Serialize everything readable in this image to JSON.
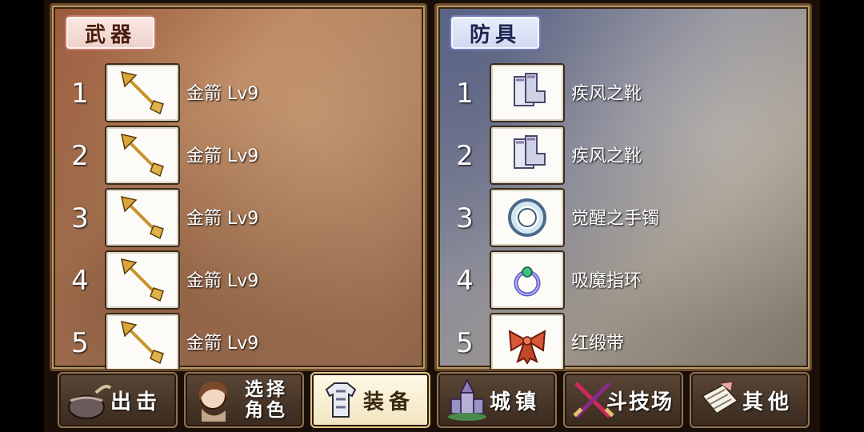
{
  "weapons_panel": {
    "title": "武器",
    "items": [
      {
        "index": "1",
        "name": "金箭 Lv9",
        "icon": "golden-arrow-icon"
      },
      {
        "index": "2",
        "name": "金箭 Lv9",
        "icon": "golden-arrow-icon"
      },
      {
        "index": "3",
        "name": "金箭 Lv9",
        "icon": "golden-arrow-icon"
      },
      {
        "index": "4",
        "name": "金箭 Lv9",
        "icon": "golden-arrow-icon"
      },
      {
        "index": "5",
        "name": "金箭 Lv9",
        "icon": "golden-arrow-icon"
      }
    ]
  },
  "armor_panel": {
    "title": "防具",
    "items": [
      {
        "index": "1",
        "name": "疾风之靴",
        "icon": "boots-icon"
      },
      {
        "index": "2",
        "name": "疾风之靴",
        "icon": "boots-icon"
      },
      {
        "index": "3",
        "name": "觉醒之手镯",
        "icon": "bracelet-icon"
      },
      {
        "index": "4",
        "name": "吸魔指环",
        "icon": "ring-icon"
      },
      {
        "index": "5",
        "name": "红缎带",
        "icon": "ribbon-icon"
      }
    ]
  },
  "nav": {
    "sortie": "出击",
    "select_line1": "选择",
    "select_line2": "角色",
    "equipment": "装备",
    "town": "城镇",
    "arena": "斗技场",
    "other": "其他",
    "active": "equipment"
  }
}
